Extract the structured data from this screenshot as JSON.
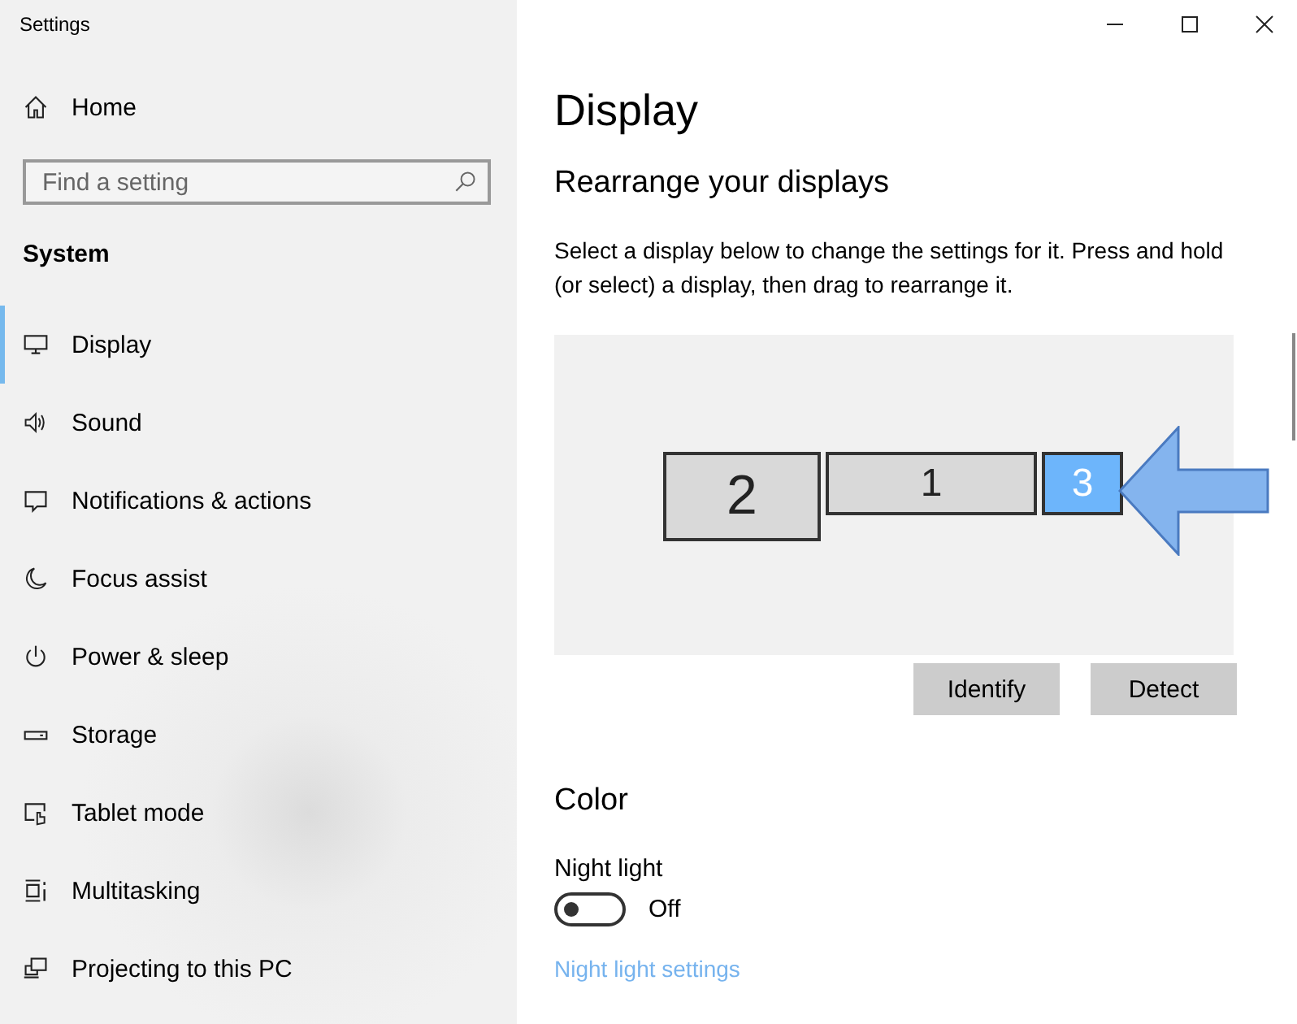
{
  "window": {
    "title": "Settings"
  },
  "sidebar": {
    "home": "Home",
    "search": {
      "placeholder": "Find a setting"
    },
    "section": "System",
    "items": [
      {
        "label": "Display",
        "selected": true
      },
      {
        "label": "Sound",
        "selected": false
      },
      {
        "label": "Notifications & actions",
        "selected": false
      },
      {
        "label": "Focus assist",
        "selected": false
      },
      {
        "label": "Power & sleep",
        "selected": false
      },
      {
        "label": "Storage",
        "selected": false
      },
      {
        "label": "Tablet mode",
        "selected": false
      },
      {
        "label": "Multitasking",
        "selected": false
      },
      {
        "label": "Projecting to this PC",
        "selected": false
      }
    ]
  },
  "main": {
    "title": "Display",
    "subtitle": "Rearrange your displays",
    "description": "Select a display below to change the settings for it. Press and hold (or select) a display, then drag to rearrange it.",
    "displays": [
      {
        "number": "2",
        "selected": false
      },
      {
        "number": "1",
        "selected": false
      },
      {
        "number": "3",
        "selected": true
      }
    ],
    "buttons": [
      "Identify",
      "Detect"
    ],
    "color_heading": "Color",
    "night_light": {
      "label": "Night light",
      "on": false,
      "state": "Off"
    },
    "link": "Night light settings"
  }
}
